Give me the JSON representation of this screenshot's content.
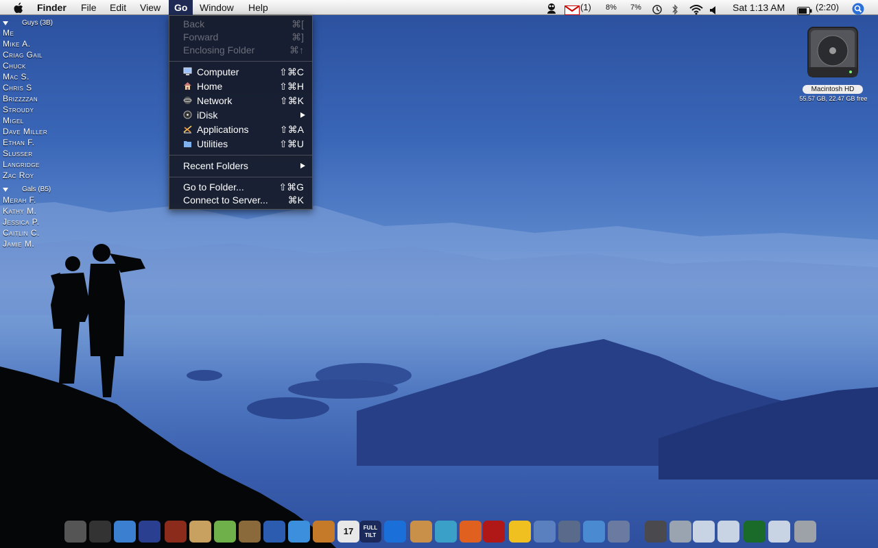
{
  "menubar": {
    "app_name": "Finder",
    "menus": [
      "File",
      "Edit",
      "View",
      "Go",
      "Window",
      "Help"
    ],
    "status": {
      "mail_count": "(1)",
      "cpu1": "8%",
      "cpu2": "7%",
      "clock": "Sat 1:13 AM",
      "battery": "(2:20)"
    }
  },
  "go_menu": {
    "items": [
      {
        "label": "Back",
        "shortcut": "⌘[",
        "enabled": false
      },
      {
        "label": "Forward",
        "shortcut": "⌘]",
        "enabled": false
      },
      {
        "label": "Enclosing Folder",
        "shortcut": "⌘↑",
        "enabled": false
      },
      {
        "label": "Computer",
        "shortcut": "⇧⌘C",
        "icon": "computer-icon"
      },
      {
        "label": "Home",
        "shortcut": "⇧⌘H",
        "icon": "home-icon"
      },
      {
        "label": "Network",
        "shortcut": "⇧⌘K",
        "icon": "network-icon"
      },
      {
        "label": "iDisk",
        "submenu": true,
        "icon": "idisk-icon"
      },
      {
        "label": "Applications",
        "shortcut": "⇧⌘A",
        "icon": "applications-icon"
      },
      {
        "label": "Utilities",
        "shortcut": "⇧⌘U",
        "icon": "utilities-folder-icon"
      },
      {
        "label": "Recent Folders",
        "submenu": true
      },
      {
        "label": "Go to Folder...",
        "shortcut": "⇧⌘G"
      },
      {
        "label": "Connect to Server...",
        "shortcut": "⌘K"
      }
    ]
  },
  "buddy_list": {
    "groups": [
      {
        "name": "Guys (3B)",
        "members": [
          "Me",
          "Mike A.",
          "Criag Gail",
          "Chuck",
          "Mac S.",
          "Chris S",
          "Brizzzzan",
          "Stroudy",
          "Migel",
          "Dave Miller",
          "Ethan F.",
          "Slusser",
          "Langridge",
          "Zac Roy"
        ]
      },
      {
        "name": "Gals (B5)",
        "members": [
          "Merah F.",
          "Kathy M.",
          "Jessica P.",
          "Caitlin C.",
          "Jamie M."
        ]
      }
    ]
  },
  "desktop_disk": {
    "name": "Macintosh HD",
    "details": "55.57 GB, 22.47 GB free"
  },
  "dock": {
    "items": [
      {
        "icon": "boot-camp-icon"
      },
      {
        "icon": "dashboard-icon"
      },
      {
        "icon": "safari-icon"
      },
      {
        "icon": "spaces-icon"
      },
      {
        "icon": "domo-icon"
      },
      {
        "icon": "address-book-icon"
      },
      {
        "icon": "itunes-icon"
      },
      {
        "icon": "iphoto-icon"
      },
      {
        "icon": "imovie-icon"
      },
      {
        "icon": "iweb-icon"
      },
      {
        "icon": "garageband-icon"
      },
      {
        "icon": "ical-icon",
        "text": "17"
      },
      {
        "icon": "full-tilt-poker-icon",
        "text": "FULL TILT"
      },
      {
        "icon": "quicktime-icon"
      },
      {
        "icon": "preview-icon"
      },
      {
        "icon": "feather-app-icon"
      },
      {
        "icon": "flame-app-icon"
      },
      {
        "icon": "photo-booth-icon"
      },
      {
        "icon": "cyberduck-icon"
      },
      {
        "icon": "itunes-network-icon"
      },
      {
        "icon": "hp-printer-icon"
      },
      {
        "icon": "network-globe-icon"
      },
      {
        "icon": "preview-screenshot-icon"
      },
      {
        "icon": "hard-drive-icon"
      },
      {
        "icon": "mail-icon"
      },
      {
        "icon": "window-thumbnail-icon"
      },
      {
        "icon": "window-thumbnail-icon"
      },
      {
        "icon": "poker-table-icon"
      },
      {
        "icon": "window-thumbnail-icon"
      },
      {
        "icon": "trash-icon"
      }
    ]
  },
  "colors": {
    "menu_bg": "#161a28",
    "menu_highlight": "#1f2b55",
    "sky": "#5b87cc"
  }
}
